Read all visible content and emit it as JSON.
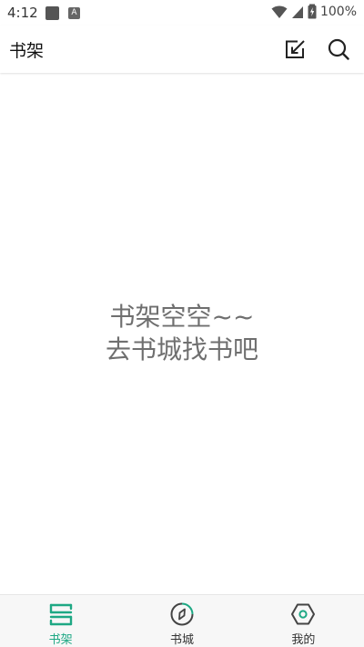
{
  "status_bar": {
    "time": "4:12",
    "battery": "100%",
    "notif_glyph": "A"
  },
  "app_bar": {
    "title": "书架",
    "actions": [
      {
        "name": "edit-check",
        "icon": "edit-check-icon"
      },
      {
        "name": "search",
        "icon": "search-icon"
      }
    ]
  },
  "empty_state": {
    "line1": "书架空空~~",
    "line2": "去书城找书吧"
  },
  "bottom_nav": {
    "items": [
      {
        "label": "书架",
        "icon": "bookshelf-icon",
        "active": true
      },
      {
        "label": "书城",
        "icon": "compass-icon",
        "active": false
      },
      {
        "label": "我的",
        "icon": "profile-hexagon-icon",
        "active": false
      }
    ]
  },
  "colors": {
    "accent": "#1ea884",
    "empty_text": "#6f6f6f",
    "nav_background": "#f7f7f7"
  }
}
